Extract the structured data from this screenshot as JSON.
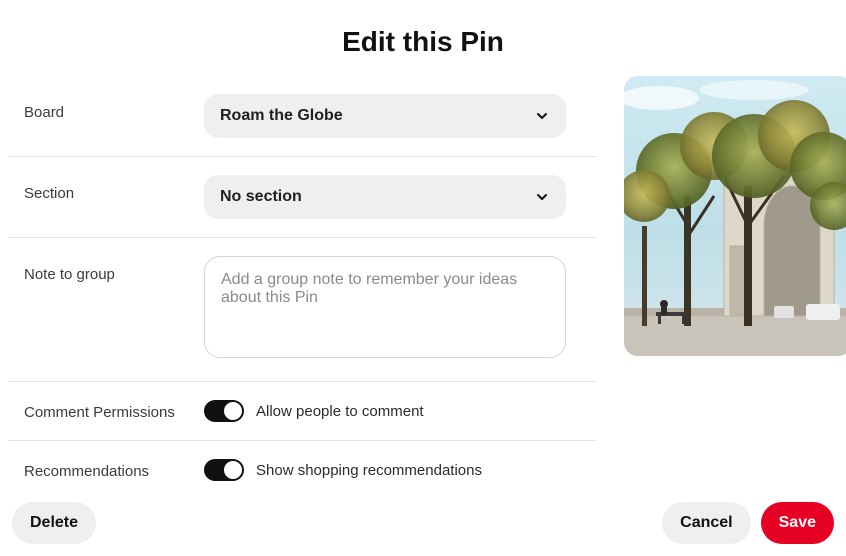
{
  "title": "Edit this Pin",
  "fields": {
    "board": {
      "label": "Board",
      "value": "Roam the Globe"
    },
    "section": {
      "label": "Section",
      "value": "No section"
    },
    "note": {
      "label": "Note to group",
      "placeholder": "Add a group note to remember your ideas about this Pin",
      "value": ""
    },
    "comments": {
      "label": "Comment Permissions",
      "toggle_label": "Allow people to comment",
      "enabled": true
    },
    "recs": {
      "label": "Recommendations",
      "toggle_label": "Show shopping recommendations",
      "enabled": true
    }
  },
  "buttons": {
    "delete": "Delete",
    "cancel": "Cancel",
    "save": "Save"
  },
  "image_alt": "Arc de Triomphe seen through trees on a sunny day"
}
